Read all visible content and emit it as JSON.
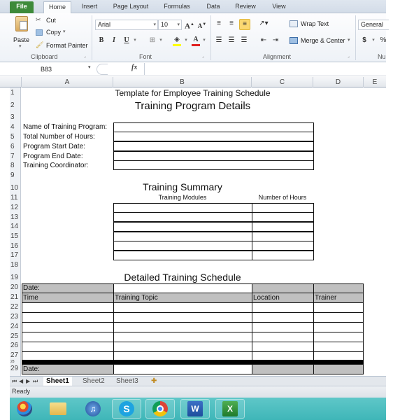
{
  "ribbon": {
    "tabs": [
      "File",
      "Home",
      "Insert",
      "Page Layout",
      "Formulas",
      "Data",
      "Review",
      "View"
    ],
    "active_tab": "Home",
    "clipboard": {
      "paste": "Paste",
      "cut": "Cut",
      "copy": "Copy",
      "format_painter": "Format Painter",
      "group_label": "Clipboard"
    },
    "font": {
      "font_name": "Arial",
      "font_size": "10",
      "bold": "B",
      "italic": "I",
      "underline": "U",
      "group_label": "Font"
    },
    "alignment": {
      "wrap_text": "Wrap Text",
      "merge_center": "Merge & Center",
      "group_label": "Alignment"
    },
    "number": {
      "format": "General",
      "currency": "$",
      "percent": "%",
      "group_label": "Nu"
    }
  },
  "formula_bar": {
    "name_box": "B83",
    "fx": "fx",
    "formula": ""
  },
  "columns": [
    "A",
    "B",
    "C",
    "D",
    "E"
  ],
  "rows": [
    "1",
    "2",
    "3",
    "4",
    "5",
    "6",
    "7",
    "8",
    "9",
    "10",
    "11",
    "12",
    "13",
    "14",
    "15",
    "16",
    "17",
    "18",
    "19",
    "20",
    "21",
    "22",
    "23",
    "24",
    "25",
    "26",
    "27",
    "28",
    "29"
  ],
  "sheet": {
    "title": "Template for Employee Training Schedule",
    "program_details": {
      "heading": "Training Program Details",
      "fields": [
        "Name of Training Program:",
        "Total Number of Hours:",
        "Program Start Date:",
        "Program End Date:",
        "Training Coordinator:"
      ]
    },
    "summary": {
      "heading": "Training Summary",
      "col_modules": "Training Modules",
      "col_hours": "Number of Hours",
      "empty_rows": 6
    },
    "schedule": {
      "heading": "Detailed Training Schedule",
      "date_label": "Date:",
      "columns": [
        "Time",
        "Training Topic",
        "Location",
        "Trainer"
      ],
      "empty_rows": 6,
      "second_date_label": "Date:"
    }
  },
  "sheet_tabs": {
    "tabs": [
      "Sheet1",
      "Sheet2",
      "Sheet3"
    ],
    "active": "Sheet1"
  },
  "status_bar": {
    "status": "Ready"
  },
  "taskbar": {
    "items": [
      "start",
      "explorer",
      "itunes",
      "skype",
      "chrome",
      "word",
      "excel"
    ],
    "word_glyph": "W",
    "excel_glyph": "X",
    "skype_glyph": "S"
  }
}
